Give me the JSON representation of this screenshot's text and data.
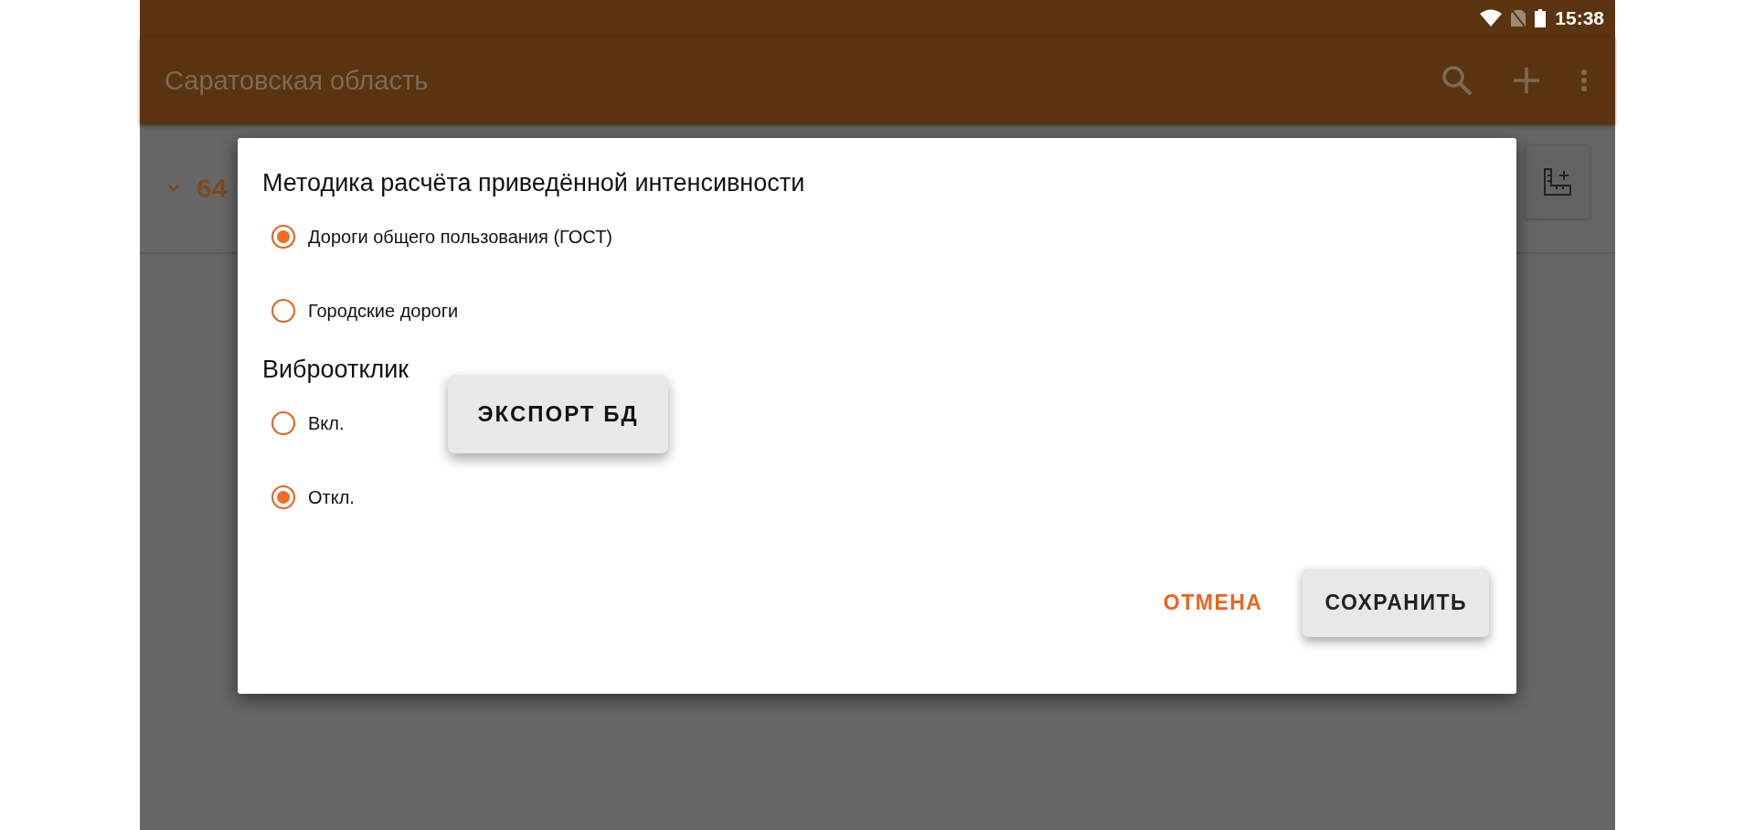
{
  "status_bar": {
    "time": "15:38"
  },
  "app_bar": {
    "title": "Саратовская область"
  },
  "list_row": {
    "label": "64"
  },
  "dialog": {
    "groups": [
      {
        "title": "Методика расчёта приведённой интенсивности",
        "options": [
          {
            "label": "Дороги общего пользования (ГОСТ)",
            "selected": true
          },
          {
            "label": "Городские дороги",
            "selected": false
          }
        ]
      },
      {
        "title": "Виброотклик",
        "options": [
          {
            "label": "Вкл.",
            "selected": false
          },
          {
            "label": "Откл.",
            "selected": true
          }
        ]
      }
    ],
    "buttons": [
      {
        "label": "ОТМЕНА",
        "kind": "text"
      },
      {
        "label": "СОХРАНИТЬ",
        "kind": "raised"
      }
    ]
  },
  "floating_button": {
    "label": "ЭКСПОРТ БД"
  }
}
